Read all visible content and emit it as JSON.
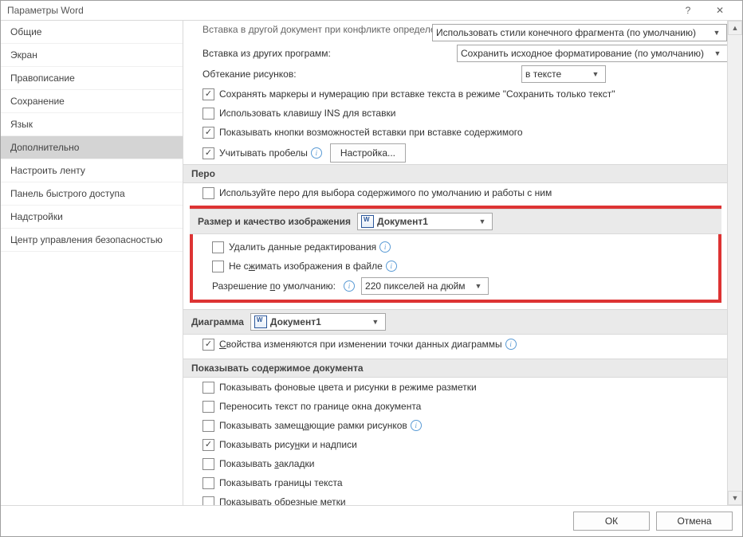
{
  "title": "Параметры Word",
  "titlebar": {
    "help": "?",
    "close": "✕"
  },
  "nav": [
    "Общие",
    "Экран",
    "Правописание",
    "Сохранение",
    "Язык",
    "Дополнительно",
    "Настроить ленту",
    "Панель быстрого доступа",
    "Надстройки",
    "Центр управления безопасностью"
  ],
  "nav_selected": 5,
  "top_rows": {
    "conflict_label": "Вставка в другой документ при конфликте определений стилей:",
    "conflict_dd": "Использовать стили конечного фрагмента (по умолчанию)",
    "other_prog_label": "Вставка из других программ:",
    "other_prog_dd": "Сохранить исходное форматирование (по умолчанию)",
    "wrap_label": "Обтекание рисунков:",
    "wrap_dd": "в тексте",
    "keep_bullets": "Сохранять маркеры и нумерацию при вставке текста в режиме \"Сохранить только текст\"",
    "ins_key": "Использовать клавишу INS для вставки",
    "paste_btns": "Показывать кнопки возможностей вставки при вставке содержимого",
    "smart_paste": "Учитывать пробелы",
    "settings_btn": "Настройка..."
  },
  "pen_section": "Перо",
  "pen_row": "Используйте перо для выбора содержимого по умолчанию и работы с ним",
  "img_section": "Размер и качество изображения",
  "img_doc": "Документ1",
  "img_rows": {
    "discard": "Удалить данные редактирования",
    "nocompress_pre": "Не с",
    "nocompress_u": "ж",
    "nocompress_post": "имать изображения в файле",
    "res_label_pre": "Разрешение ",
    "res_label_u": "п",
    "res_label_post": "о умолчанию:",
    "res_dd": "220 пикселей на дюйм"
  },
  "chart_section": "Диаграмма",
  "chart_doc": "Документ1",
  "chart_row_pre": "",
  "chart_row_u": "С",
  "chart_row_post": "войства изменяются при изменении точки данных диаграммы",
  "content_section": "Показывать содержимое документа",
  "content_rows": [
    {
      "t": "Показывать фоновые цвета и рисунки в режиме разметки",
      "c": false
    },
    {
      "t": "Переносить текст по границе окна документа",
      "c": false
    },
    {
      "pre": "Показывать замещ",
      "u": "а",
      "post": "ющие рамки рисунков",
      "c": false,
      "info": true
    },
    {
      "pre": "Показывать рису",
      "u": "н",
      "post": "ки и надписи",
      "c": true
    },
    {
      "pre": "Показывать ",
      "u": "з",
      "post": "акладки",
      "c": false
    },
    {
      "t": "Показывать границы текста",
      "c": false
    },
    {
      "t": "Показывать обрезные метки",
      "c": false
    }
  ],
  "footer": {
    "ok": "ОК",
    "cancel": "Отмена"
  }
}
